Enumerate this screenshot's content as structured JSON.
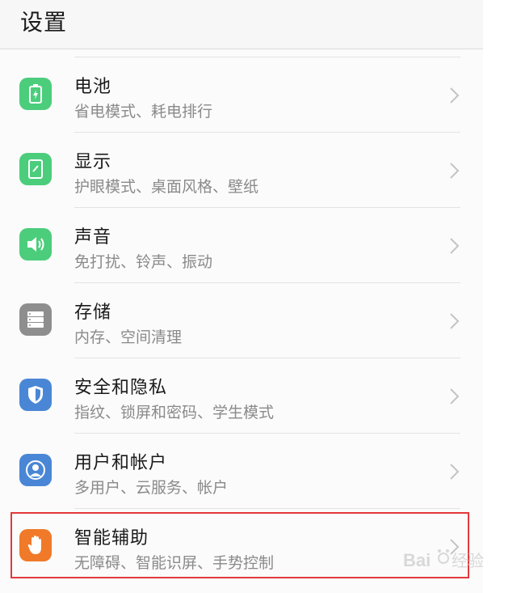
{
  "header": {
    "title": "设置"
  },
  "items": [
    {
      "label": "电池",
      "sub": "省电模式、耗电排行",
      "icon": "battery-icon",
      "color": "#4ccd7c"
    },
    {
      "label": "显示",
      "sub": "护眼模式、桌面风格、壁纸",
      "icon": "display-icon",
      "color": "#4ccd7c"
    },
    {
      "label": "声音",
      "sub": "免打扰、铃声、振动",
      "icon": "sound-icon",
      "color": "#4ccd7c"
    },
    {
      "label": "存储",
      "sub": "内存、空间清理",
      "icon": "storage-icon",
      "color": "#8e8e8e"
    },
    {
      "label": "安全和隐私",
      "sub": "指纹、锁屏和密码、学生模式",
      "icon": "shield-icon",
      "color": "#4a86d6"
    },
    {
      "label": "用户和帐户",
      "sub": "多用户、云服务、帐户",
      "icon": "user-icon",
      "color": "#4a86d6"
    },
    {
      "label": "智能辅助",
      "sub": "无障碍、智能识屏、手势控制",
      "icon": "hand-icon",
      "color": "#f07a2a"
    }
  ],
  "highlight_color": "#e4393c",
  "watermark": "Bai经验"
}
